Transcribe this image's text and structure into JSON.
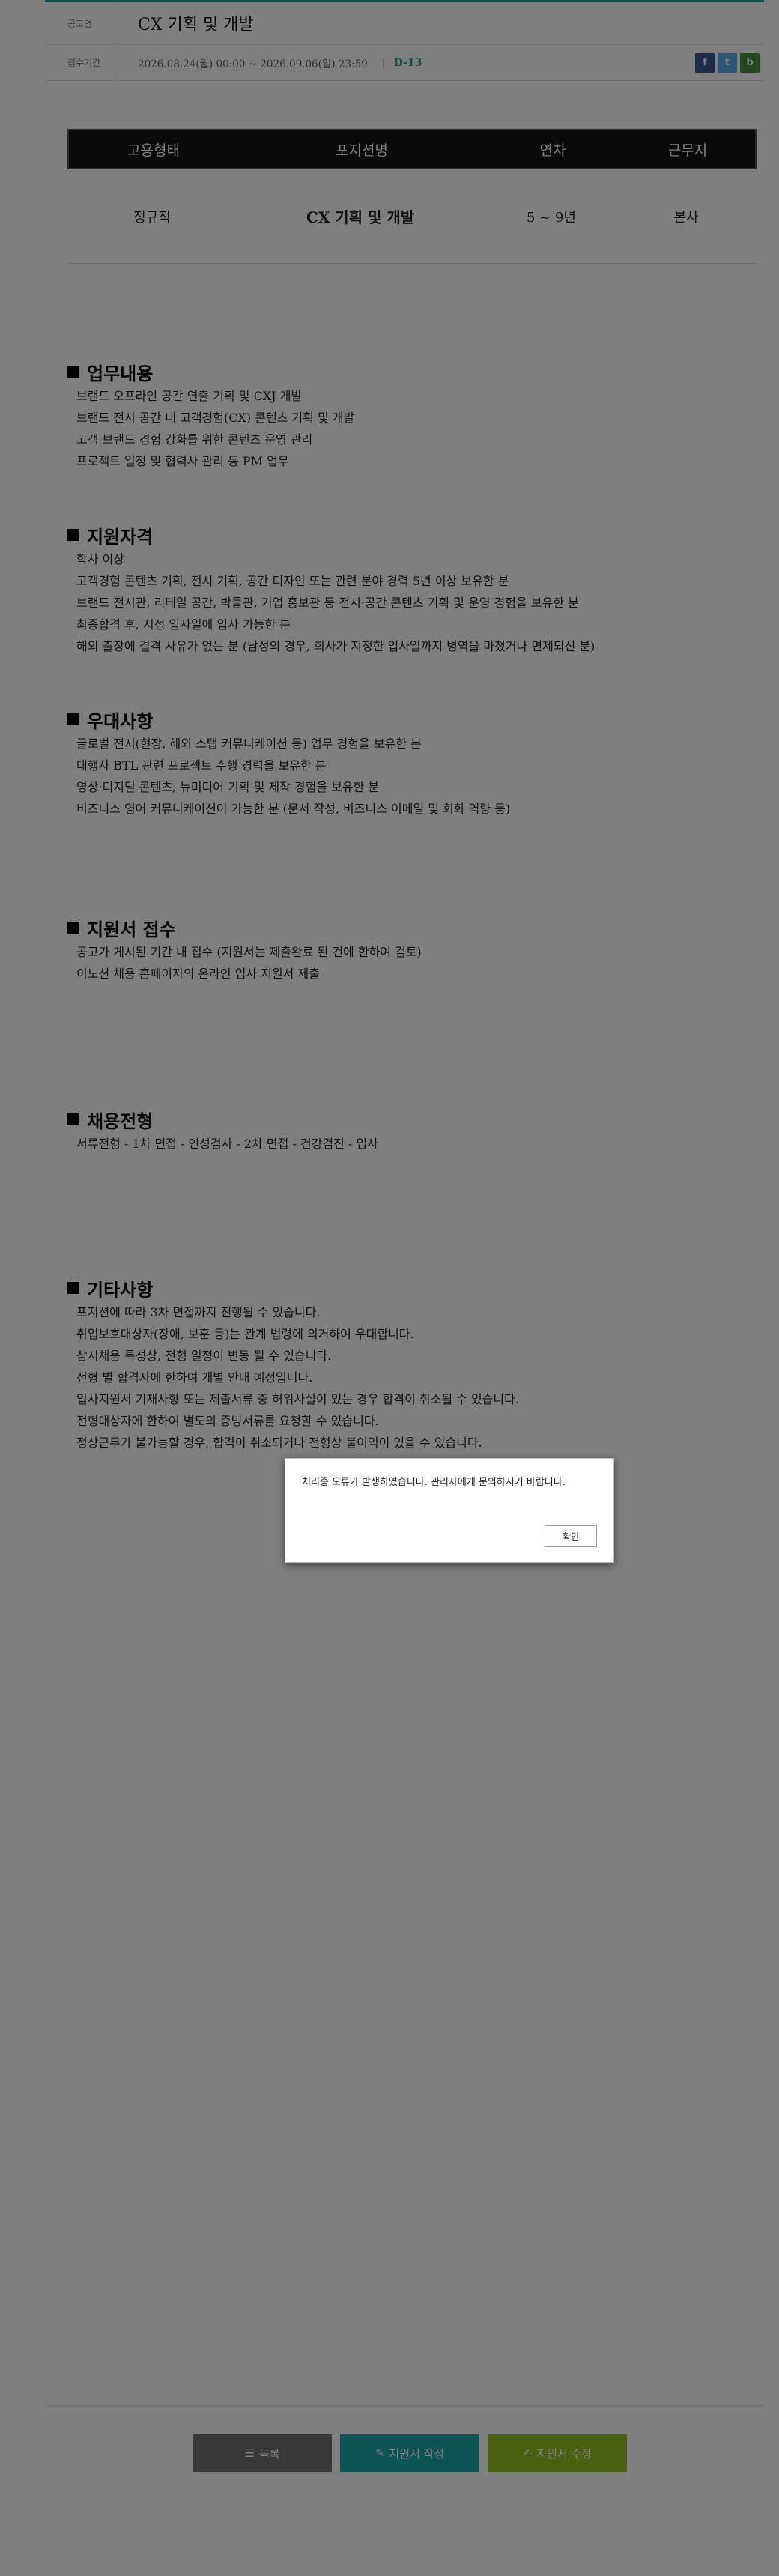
{
  "header": {
    "label_post": "공고명",
    "title": "CX 기획 및 개발",
    "label_period": "접수기간",
    "period": "2026.08.24(월) 00:00 ~ 2026.09.06(일) 23:59",
    "dday": "D-13",
    "share": [
      {
        "name": "facebook-icon",
        "glyph": "f"
      },
      {
        "name": "twitter-icon",
        "glyph": "t"
      },
      {
        "name": "band-icon",
        "glyph": "b"
      }
    ]
  },
  "summary": {
    "headers": [
      "고용형태",
      "포지션명",
      "연차",
      "근무지"
    ],
    "values": [
      "정규직",
      "CX 기획 및 개발",
      "5 ~ 9년",
      "본사"
    ]
  },
  "sections": [
    {
      "title": "업무내용",
      "items": [
        "브랜드 오프라인 공간 연출 기획 및 CXJ 개발",
        "브랜드 전시 공간 내 고객경험(CX) 콘텐츠 기획 및 개발",
        "고객 브랜드 경험 강화를 위한 콘텐츠 운영 관리",
        "프로젝트 일정 및 협력사 관리 등 PM 업무"
      ]
    },
    {
      "title": "지원자격",
      "items": [
        "학사 이상",
        "고객경험 콘텐츠 기획, 전시 기획, 공간 디자인 또는 관련 분야 경력 5년 이상 보유한 분",
        "브랜드 전시관, 리테일 공간, 박물관, 기업 홍보관 등 전시·공간 콘텐츠 기획 및 운영 경험을 보유한 분",
        "최종합격 후, 지정 입사일에 입사 가능한 분",
        "해외 출장에 결격 사유가 없는 분 (남성의 경우, 회사가 지정한 입사일까지 병역을 마쳤거나 면제되신 분)"
      ]
    },
    {
      "title": "우대사항",
      "items": [
        "글로벌 전시(현장, 해외 스탭 커뮤니케이션 등) 업무 경험을 보유한 분",
        "대행사 BTL 관련 프로젝트 수행 경력을 보유한 분",
        "영상·디지털 콘텐츠, 뉴미디어 기획 및 제작 경험을 보유한 분",
        "비즈니스 영어 커뮤니케이션이 가능한 분 (문서 작성, 비즈니스 이메일 및 회화 역량 등)"
      ]
    },
    {
      "title": "지원서 접수",
      "items": [
        "공고가 게시된 기간 내 접수 (지원서는 제출완료 된 건에 한하여 검토)",
        "이노션 채용 홈페이지의 온라인 입사 지원서 제출"
      ]
    },
    {
      "title": "채용전형",
      "items": [
        "서류전형  -  1차 면접  -  인성검사  -  2차 면접  -  건강검진  -  입사"
      ]
    },
    {
      "title": "기타사항",
      "items": [
        "포지션에 따라 3차 면접까지 진행될 수 있습니다.",
        "취업보호대상자(장애, 보훈 등)는 관계 법령에 의거하여 우대합니다.",
        "상시채용 특성상, 전형 일정이 변동 될 수 있습니다.",
        "전형 별 합격자에 한하여 개별 안내 예정입니다.",
        "입사지원서 기재사항 또는 제출서류 중 허위사실이 있는 경우 합격이 취소될 수 있습니다.",
        "전형대상자에 한하여 별도의 증빙서류를 요청할 수 있습니다.",
        "정상근무가 불가능할 경우, 합격이 취소되거나 전형상 불이익이 있을 수 있습니다."
      ]
    }
  ],
  "buttons": {
    "list": "목록",
    "write": "지원서 작성",
    "edit": "지원서 수정"
  },
  "modal": {
    "message": "처리중 오류가 발생하였습니다. 관리자에게 문의하시기 바랍니다.",
    "confirm": "확인"
  }
}
